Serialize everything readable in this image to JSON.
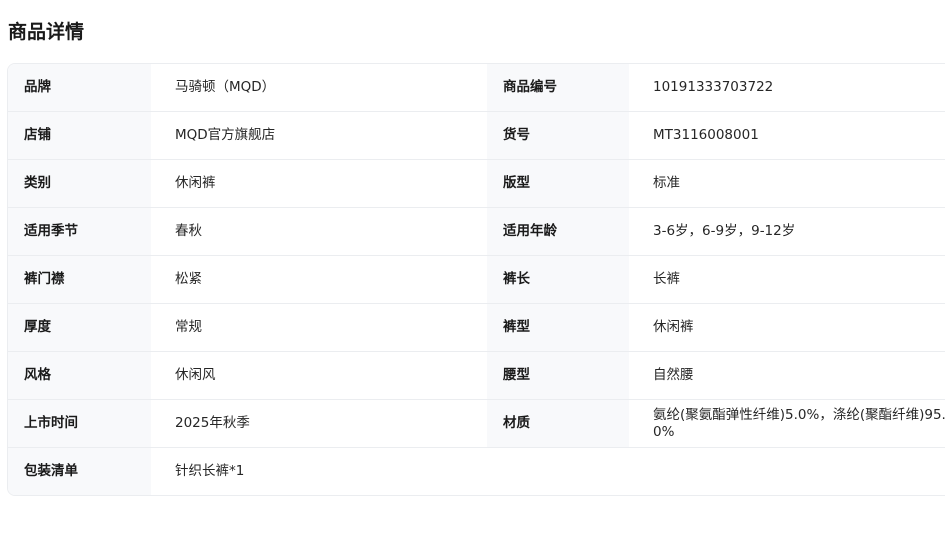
{
  "title": "商品详情",
  "rows": [
    {
      "k1": "品牌",
      "v1": "马骑顿（MQD）",
      "k2": "商品编号",
      "v2": "10191333703722"
    },
    {
      "k1": "店铺",
      "v1": "MQD官方旗舰店",
      "k2": "货号",
      "v2": "MT3116008001"
    },
    {
      "k1": "类别",
      "v1": "休闲裤",
      "k2": "版型",
      "v2": "标准"
    },
    {
      "k1": "适用季节",
      "v1": "春秋",
      "k2": "适用年龄",
      "v2": "3-6岁，6-9岁，9-12岁"
    },
    {
      "k1": "裤门襟",
      "v1": "松紧",
      "k2": "裤长",
      "v2": "长裤"
    },
    {
      "k1": "厚度",
      "v1": "常规",
      "k2": "裤型",
      "v2": "休闲裤"
    },
    {
      "k1": "风格",
      "v1": "休闲风",
      "k2": "腰型",
      "v2": "自然腰"
    },
    {
      "k1": "上市时间",
      "v1": "2025年秋季",
      "k2": "材质",
      "v2": "氨纶(聚氨酯弹性纤维)5.0%，涤纶(聚酯纤维)95.0%"
    },
    {
      "k1": "包装清单",
      "v1": "针织长裤*1"
    }
  ]
}
